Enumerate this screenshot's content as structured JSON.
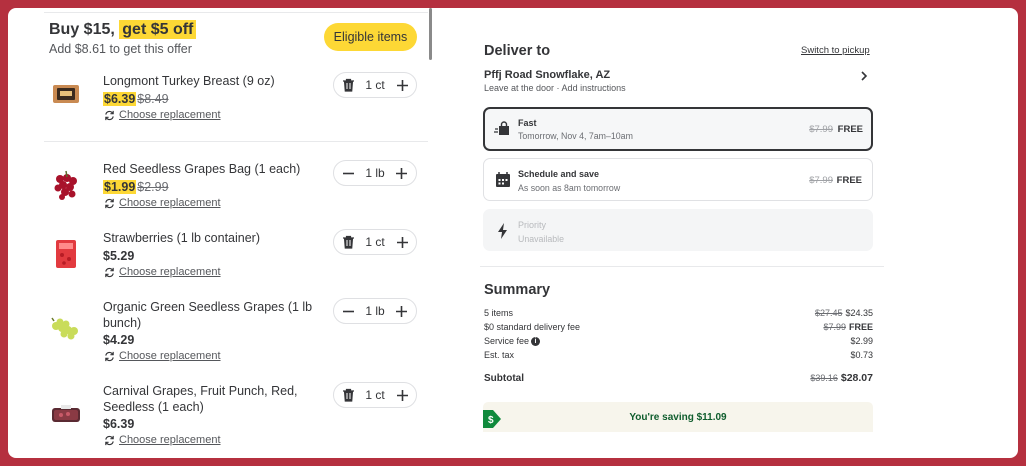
{
  "offer": {
    "title_prefix": "Buy $15,",
    "title_highlight": "get $5 off",
    "subtitle": "Add $8.61 to get this offer",
    "eligible_label": "Eligible items"
  },
  "items": [
    {
      "name": "Longmont Turkey Breast (9 oz)",
      "price": "$6.39",
      "old_price": "$8.49",
      "on_sale": true,
      "qty": "1 ct",
      "replace_label": "Choose replacement",
      "stepper_left_icon": "trash-icon"
    },
    {
      "name": "Red Seedless Grapes Bag (1 each)",
      "price": "$1.99",
      "old_price": "$2.99",
      "on_sale": true,
      "qty": "1 lb",
      "replace_label": "Choose replacement",
      "stepper_left_icon": "minus-icon"
    },
    {
      "name": "Strawberries (1 lb container)",
      "price": "$5.29",
      "qty": "1 ct",
      "replace_label": "Choose replacement",
      "stepper_left_icon": "trash-icon"
    },
    {
      "name": "Organic Green Seedless Grapes (1 lb bunch)",
      "price": "$4.29",
      "qty": "1 lb",
      "replace_label": "Choose replacement",
      "stepper_left_icon": "minus-icon"
    },
    {
      "name": "Carnival Grapes, Fruit Punch, Red, Seedless (1 each)",
      "price": "$6.39",
      "qty": "1 ct",
      "replace_label": "Choose replacement",
      "stepper_left_icon": "trash-icon"
    }
  ],
  "delivery": {
    "title": "Deliver to",
    "switch_label": "Switch to pickup",
    "address": "Pffj Road Snowflake, AZ",
    "address_sub": "Leave at the door · Add instructions",
    "options": [
      {
        "title": "Fast",
        "subtitle": "Tomorrow, Nov 4, 7am–10am",
        "old_price": "$7.99",
        "price": "FREE",
        "selected": true
      },
      {
        "title": "Schedule and save",
        "subtitle": "As soon as 8am tomorrow",
        "old_price": "$7.99",
        "price": "FREE"
      },
      {
        "title": "Priority",
        "subtitle": "Unavailable",
        "disabled": true
      }
    ]
  },
  "summary": {
    "title": "Summary",
    "rows": [
      {
        "label": "5 items",
        "old": "$27.45",
        "value": "$24.35"
      },
      {
        "label": "$0 standard delivery fee",
        "old": "$7.99",
        "value": "FREE",
        "bold": true
      },
      {
        "label": "Service fee",
        "value": "$2.99",
        "info": true
      },
      {
        "label": "Est. tax",
        "value": "$0.73"
      }
    ],
    "subtotal_label": "Subtotal",
    "subtotal_old": "$39.16",
    "subtotal_value": "$28.07",
    "saving_text": "You're saving $11.09"
  },
  "colors": {
    "highlight": "#fdd835",
    "frame_border": "#b5303f",
    "saving_green": "#0f5d2d"
  }
}
